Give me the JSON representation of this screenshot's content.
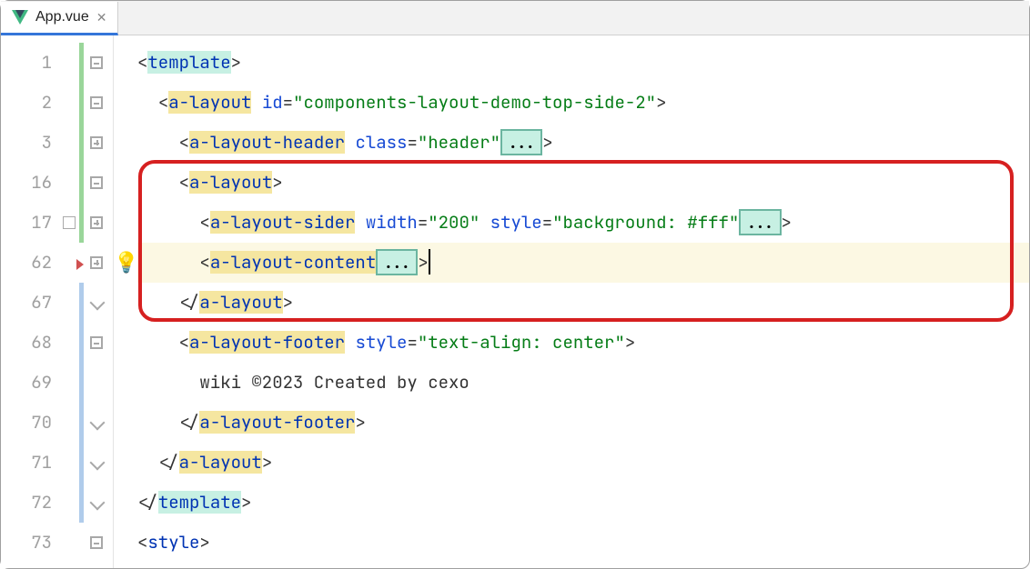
{
  "tab": {
    "label": "App.vue"
  },
  "lines": {
    "n1": "1",
    "n2": "2",
    "n3": "3",
    "n16": "16",
    "n17": "17",
    "n62": "62",
    "n67": "67",
    "n68": "68",
    "n69": "69",
    "n70": "70",
    "n71": "71",
    "n72": "72",
    "n73": "73"
  },
  "code": {
    "l1": {
      "open": "<",
      "tag": "template",
      "close": ">"
    },
    "l2": {
      "open": "<",
      "tag": "a-layout",
      "sp": " ",
      "attr": "id",
      "eq": "=",
      "val": "\"components-layout-demo-top-side-2\"",
      "close": ">"
    },
    "l3": {
      "open": "<",
      "tag": "a-layout-header",
      "sp": " ",
      "attr": "class",
      "eq": "=",
      "val": "\"header\"",
      "ellipsis": "...",
      "close": ">"
    },
    "l16": {
      "open": "<",
      "tag": "a-layout",
      "close": ">"
    },
    "l17": {
      "open": "<",
      "tag": "a-layout-sider",
      "sp": " ",
      "attr1": "width",
      "eq": "=",
      "val1": "\"200\"",
      "sp2": " ",
      "attr2": "style",
      "val2": "\"background: #fff\"",
      "ellipsis": "...",
      "close": ">"
    },
    "l62": {
      "open": "<",
      "tag": "a-layout-content",
      "ellipsis": "...",
      "close": ">"
    },
    "l67": {
      "open": "</",
      "tag": "a-layout",
      "close": ">"
    },
    "l68": {
      "open": "<",
      "tag": "a-layout-footer",
      "sp": " ",
      "attr": "style",
      "eq": "=",
      "val": "\"text-align: center\"",
      "close": ">"
    },
    "l69": {
      "text": "wiki ©2023 Created by cexo"
    },
    "l70": {
      "open": "</",
      "tag": "a-layout-footer",
      "close": ">"
    },
    "l71": {
      "open": "</",
      "tag": "a-layout",
      "close": ">"
    },
    "l72": {
      "open": "</",
      "tag": "template",
      "close": ">"
    },
    "l73": {
      "open": "<",
      "tag": "style",
      "close": ">"
    }
  }
}
